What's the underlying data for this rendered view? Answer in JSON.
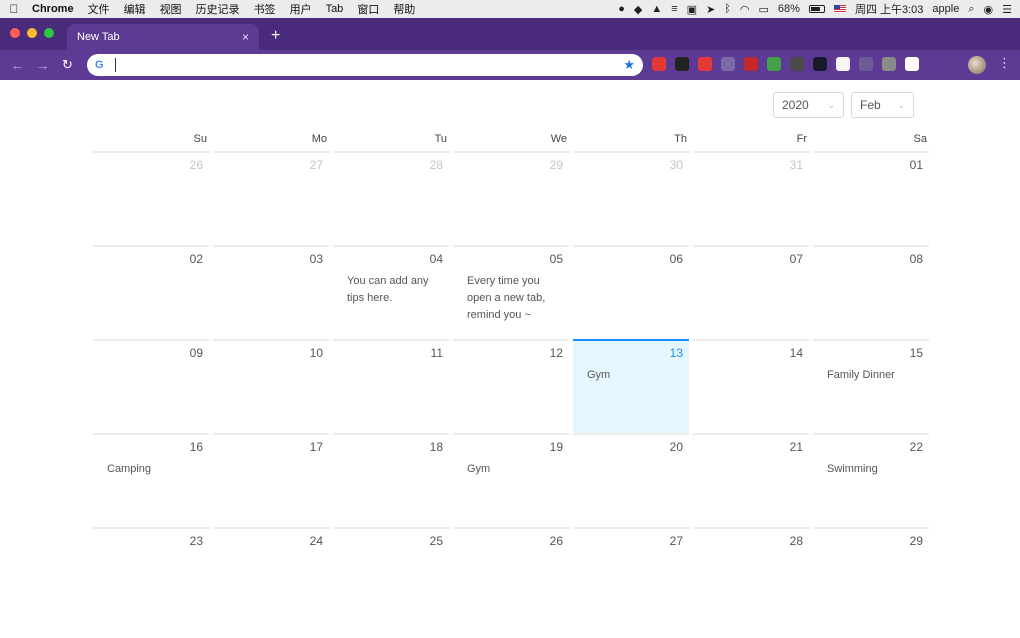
{
  "menubar": {
    "app": "Chrome",
    "items": [
      "文件",
      "编辑",
      "视图",
      "历史记录",
      "书签",
      "用户",
      "Tab",
      "窗口",
      "帮助"
    ],
    "battery": "68%",
    "clock": "周四 上午3:03",
    "user": "apple"
  },
  "browser": {
    "tab_title": "New Tab",
    "tab_close": "×",
    "new_tab": "+",
    "back": "←",
    "forward": "→",
    "reload": "↻",
    "omnibox_value": "",
    "google_glyph": "G",
    "star": "★",
    "menu": "⋮"
  },
  "calendar": {
    "year": "2020",
    "month": "Feb",
    "chevron": "⌄",
    "weekdays": [
      "Su",
      "Mo",
      "Tu",
      "We",
      "Th",
      "Fr",
      "Sa"
    ],
    "weeks": [
      [
        {
          "day": "26",
          "muted": true,
          "note": ""
        },
        {
          "day": "27",
          "muted": true,
          "note": ""
        },
        {
          "day": "28",
          "muted": true,
          "note": ""
        },
        {
          "day": "29",
          "muted": true,
          "note": ""
        },
        {
          "day": "30",
          "muted": true,
          "note": ""
        },
        {
          "day": "31",
          "muted": true,
          "note": ""
        },
        {
          "day": "01",
          "muted": false,
          "note": ""
        }
      ],
      [
        {
          "day": "02",
          "muted": false,
          "note": ""
        },
        {
          "day": "03",
          "muted": false,
          "note": ""
        },
        {
          "day": "04",
          "muted": false,
          "note": "You can add any tips here."
        },
        {
          "day": "05",
          "muted": false,
          "note": "Every time you open a new tab, remind you ~"
        },
        {
          "day": "06",
          "muted": false,
          "note": ""
        },
        {
          "day": "07",
          "muted": false,
          "note": ""
        },
        {
          "day": "08",
          "muted": false,
          "note": ""
        }
      ],
      [
        {
          "day": "09",
          "muted": false,
          "note": ""
        },
        {
          "day": "10",
          "muted": false,
          "note": ""
        },
        {
          "day": "11",
          "muted": false,
          "note": ""
        },
        {
          "day": "12",
          "muted": false,
          "note": ""
        },
        {
          "day": "13",
          "muted": false,
          "note": "Gym",
          "today": true
        },
        {
          "day": "14",
          "muted": false,
          "note": ""
        },
        {
          "day": "15",
          "muted": false,
          "note": "Family Dinner"
        }
      ],
      [
        {
          "day": "16",
          "muted": false,
          "note": "Camping"
        },
        {
          "day": "17",
          "muted": false,
          "note": ""
        },
        {
          "day": "18",
          "muted": false,
          "note": ""
        },
        {
          "day": "19",
          "muted": false,
          "note": "Gym"
        },
        {
          "day": "20",
          "muted": false,
          "note": ""
        },
        {
          "day": "21",
          "muted": false,
          "note": ""
        },
        {
          "day": "22",
          "muted": false,
          "note": "Swimming"
        }
      ],
      [
        {
          "day": "23",
          "muted": false,
          "note": ""
        },
        {
          "day": "24",
          "muted": false,
          "note": ""
        },
        {
          "day": "25",
          "muted": false,
          "note": ""
        },
        {
          "day": "26",
          "muted": false,
          "note": ""
        },
        {
          "day": "27",
          "muted": false,
          "note": ""
        },
        {
          "day": "28",
          "muted": false,
          "note": ""
        },
        {
          "day": "29",
          "muted": false,
          "note": ""
        }
      ]
    ]
  },
  "extensions": [
    {
      "name": "red-badge-extension-icon",
      "color": "#e53935"
    },
    {
      "name": "chevron-extension-icon",
      "color": "#222222"
    },
    {
      "name": "red-square-extension-icon",
      "color": "#e53935"
    },
    {
      "name": "braces-extension-icon",
      "color": "#7a6aa8"
    },
    {
      "name": "red-pill-extension-icon",
      "color": "#c62828"
    },
    {
      "name": "green-mail-extension-icon",
      "color": "#43a047"
    },
    {
      "name": "dark-extension-icon",
      "color": "#4a4a4a"
    },
    {
      "name": "cursor-extension-icon",
      "color": "#1a1a2e"
    },
    {
      "name": "c-extension-icon",
      "color": "#f5f5f5"
    },
    {
      "name": "faded-extension-icon",
      "color": "#6e5a94"
    },
    {
      "name": "grey-extension-icon",
      "color": "#8a8a8a"
    },
    {
      "name": "white-square-extension-icon",
      "color": "#ffffff"
    }
  ],
  "colors": {
    "chrome_frame": "#4a2a7a",
    "chrome_toolbar": "#5d3b95",
    "today_accent": "#1890ff",
    "today_bg": "#e6f6fe"
  }
}
